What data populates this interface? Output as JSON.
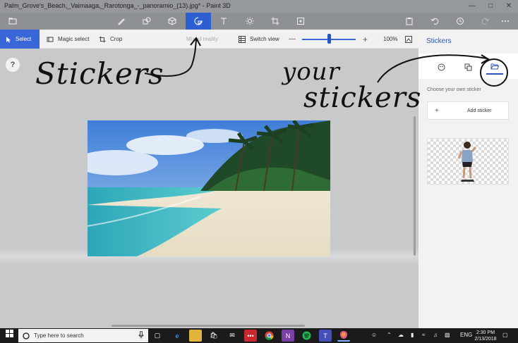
{
  "window": {
    "title": "Palm_Grove's_Beach,_Vaimaaga,_Rarotonga_-_panoramio_(13).jpg* - Paint 3D",
    "controls": [
      "—",
      "□",
      "✕"
    ]
  },
  "toptools": {
    "menu_icon": "folder-icon",
    "items": [
      {
        "name": "brushes",
        "icon": "brush-icon"
      },
      {
        "name": "2d-shapes",
        "icon": "2d-shapes-icon"
      },
      {
        "name": "3d-shapes",
        "icon": "3d-shapes-icon"
      },
      {
        "name": "stickers",
        "icon": "stickers-icon",
        "active": true
      },
      {
        "name": "text",
        "icon": "text-icon"
      },
      {
        "name": "effects",
        "icon": "effects-icon"
      },
      {
        "name": "canvas",
        "icon": "canvas-icon"
      },
      {
        "name": "remix3d",
        "icon": "remix3d-icon"
      }
    ],
    "right_icons": [
      "paste-icon",
      "undo-icon",
      "history-icon",
      "redo-icon",
      "more-icon"
    ]
  },
  "cmdbar": {
    "select_label": "Select",
    "magic_select_label": "Magic select",
    "crop_label": "Crop",
    "mixed_reality_label": "Mixed reality",
    "switch_view_label": "Switch view",
    "zoom_minus": "—",
    "zoom_plus": "+",
    "zoom_value": "100%",
    "zoom_fraction": 0.48
  },
  "canvas": {
    "help_label": "?"
  },
  "annotations": {
    "stickers_text": "Stickers",
    "your_text": "your",
    "your_stickers_text": "stickers"
  },
  "panel": {
    "title": "Stickers",
    "tabs": [
      {
        "icon": "sticker-icon"
      },
      {
        "icon": "shapes-icon"
      },
      {
        "icon": "folder-open-icon",
        "active": true
      }
    ],
    "choose_label": "Choose your own sticker",
    "add_label": "Add sticker",
    "add_plus": "+"
  },
  "taskbar": {
    "search_placeholder": "Type here to search",
    "language": "ENG",
    "time": "2:30 PM",
    "date": "2/13/2018",
    "apps": [
      "task-view-icon",
      "edge-icon",
      "file-explorer-icon",
      "store-icon",
      "mail-icon",
      "app-red-icon",
      "chrome-icon",
      "onenote-icon",
      "spotify-icon",
      "teams-icon",
      "paint3d-icon"
    ]
  }
}
